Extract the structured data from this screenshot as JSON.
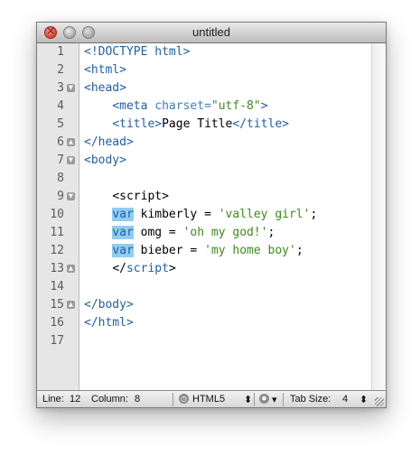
{
  "window": {
    "title": "untitled"
  },
  "gutter": {
    "line_numbers": [
      "1",
      "2",
      "3",
      "4",
      "5",
      "6",
      "7",
      "8",
      "9",
      "10",
      "11",
      "12",
      "13",
      "14",
      "15",
      "16",
      "17"
    ]
  },
  "code": {
    "l1": {
      "a": "<!DOCTYPE html>"
    },
    "l2": {
      "a": "<html>"
    },
    "l3": {
      "a": "<head>"
    },
    "l4": {
      "indent": "    ",
      "a": "<meta",
      "b": " charset=",
      "c": "\"utf-8\"",
      "d": ">"
    },
    "l5": {
      "indent": "    ",
      "a": "<title>",
      "b": "Page Title",
      "c": "</title>"
    },
    "l6": {
      "a": "</head>"
    },
    "l7": {
      "a": "<body>"
    },
    "l9": {
      "indent": "    ",
      "a": "<script>"
    },
    "l10": {
      "indent": "    ",
      "kw": "var",
      "b": " kimberly = ",
      "c": "'valley girl'",
      "d": ";"
    },
    "l11": {
      "indent": "    ",
      "kw": "var",
      "b": " omg = ",
      "c": "'oh my god!'",
      "d": ";"
    },
    "l12": {
      "indent": "    ",
      "kw": "var",
      "b": " bieber = ",
      "c": "'my home boy'",
      "d": ";"
    },
    "l13": {
      "indent": "    ",
      "a": "</",
      "b": "script",
      "c": ">"
    },
    "l15": {
      "a": "</body>"
    },
    "l16": {
      "a": "</html>"
    }
  },
  "statusbar": {
    "line_label": "Line:",
    "line_value": "12",
    "column_label": "Column:",
    "column_value": "8",
    "language": "HTML5",
    "tab_size_label": "Tab Size:",
    "tab_size_value": "4",
    "updown": "⬍",
    "dropdown": "▾"
  }
}
